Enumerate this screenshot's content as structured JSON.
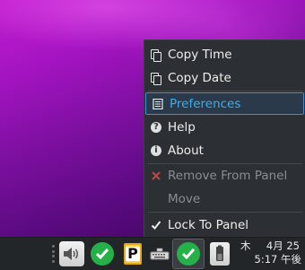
{
  "menu": {
    "items": [
      {
        "label": "Copy Time",
        "icon": "copy-icon"
      },
      {
        "label": "Copy Date",
        "icon": "copy-icon"
      },
      {
        "label": "Preferences",
        "icon": "preferences-icon",
        "selected": true
      },
      {
        "label": "Help",
        "icon": "help-icon"
      },
      {
        "label": "About",
        "icon": "info-icon"
      },
      {
        "label": "Remove From Panel",
        "icon": "remove-icon",
        "disabled": true
      },
      {
        "label": "Move",
        "icon": "",
        "disabled": true
      },
      {
        "label": "Lock To Panel",
        "icon": "checkmark-icon",
        "checked": true
      }
    ]
  },
  "taskbar": {
    "clock": {
      "weekday": "木",
      "date": "4月 25",
      "time": "5:17 午後"
    },
    "tray_icons": [
      "volume-icon",
      "update-ok-icon",
      "clipboard-icon",
      "keyboard-icon",
      "active-checkmark-icon",
      "battery-icon"
    ]
  },
  "colors": {
    "menu_bg": "#2c2f33",
    "selected": "#3daee9",
    "taskbar_bg": "#232629",
    "green": "#26b04a"
  }
}
